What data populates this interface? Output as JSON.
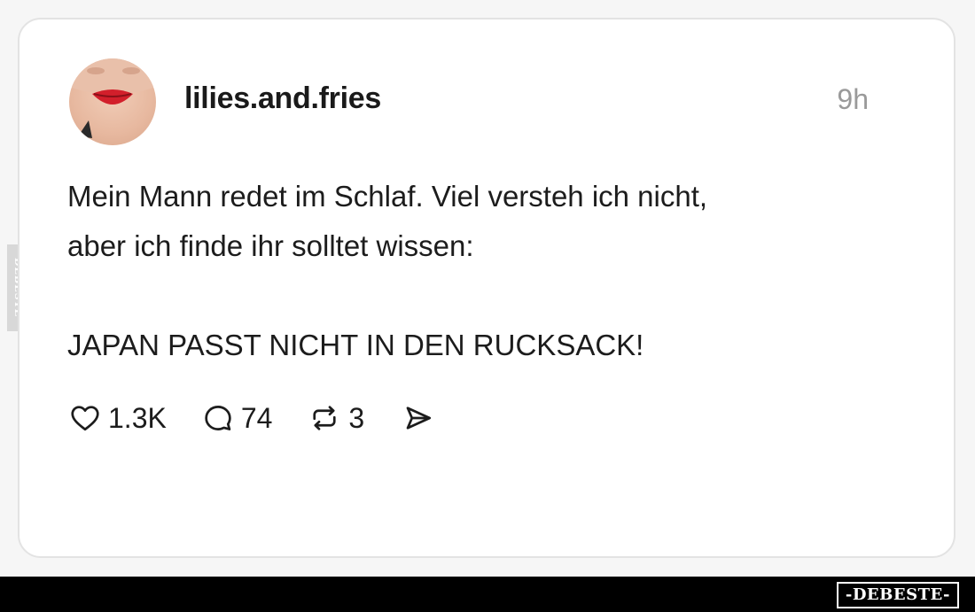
{
  "post": {
    "username": "lilies.and.fries",
    "time": "9h",
    "text_line1": "Mein Mann redet im Schlaf. Viel versteh ich nicht,",
    "text_line2": "aber ich finde ihr solltet wissen:",
    "text_line3": "JAPAN PASST NICHT IN DEN RUCKSACK!"
  },
  "actions": {
    "likes": "1.3K",
    "comments": "74",
    "reposts": "3",
    "like_icon": "heart-icon",
    "comment_icon": "comment-bubble-icon",
    "repost_icon": "repost-icon",
    "share_icon": "send-icon"
  },
  "watermark": {
    "side": "DEBESTE",
    "footer": "-DEBESTE-"
  },
  "colors": {
    "card_background": "#ffffff",
    "text": "#1c1c1c",
    "muted": "#9a9a9a",
    "footer_background": "#000000"
  }
}
